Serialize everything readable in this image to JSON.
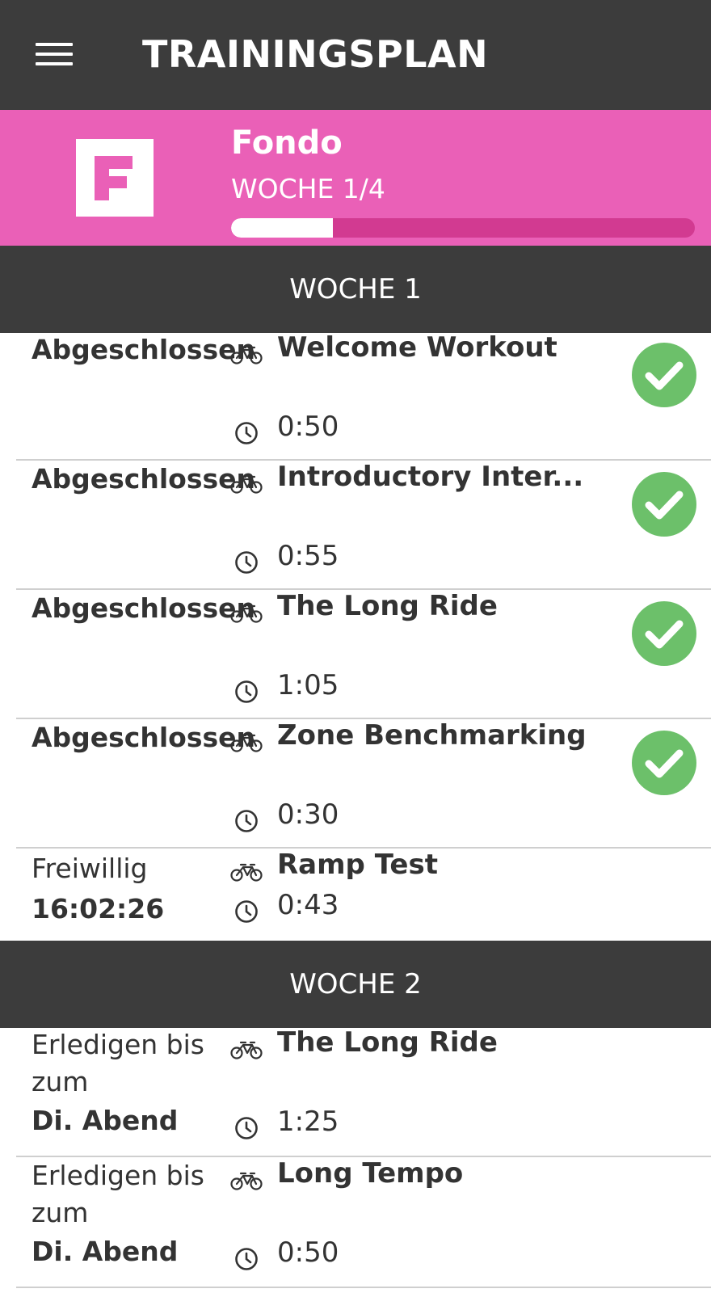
{
  "header": {
    "title": "TRAININGSPLAN",
    "menu_icon": "hamburger-menu-icon"
  },
  "plan": {
    "name": "Fondo",
    "logo_letter": "F",
    "week_label": "WOCHE 1/4",
    "progress_fraction": 0.22,
    "colors": {
      "banner": "#ea60b7",
      "track": "#d23a91",
      "fill": "#ffffff"
    }
  },
  "weeks": [
    {
      "title": "WOCHE 1",
      "workouts": [
        {
          "status": "Abgeschlossen",
          "status_detail": "",
          "name": "Welcome Workout",
          "duration": "0:50",
          "completed": true
        },
        {
          "status": "Abgeschlossen",
          "status_detail": "",
          "name": "Introductory Inter...",
          "duration": "0:55",
          "completed": true
        },
        {
          "status": "Abgeschlossen",
          "status_detail": "",
          "name": "The Long Ride",
          "duration": "1:05",
          "completed": true
        },
        {
          "status": "Abgeschlossen",
          "status_detail": "",
          "name": "Zone Benchmarking",
          "duration": "0:30",
          "completed": true
        },
        {
          "status": "Freiwillig",
          "status_detail": "16:02:26",
          "name": "Ramp Test",
          "duration": "0:43",
          "completed": false
        }
      ]
    },
    {
      "title": "WOCHE 2",
      "workouts": [
        {
          "status": "Erledigen bis zum",
          "status_detail": "Di. Abend",
          "name": "The Long Ride",
          "duration": "1:25",
          "completed": false
        },
        {
          "status": "Erledigen bis zum",
          "status_detail": "Di. Abend",
          "name": "Long Tempo",
          "duration": "0:50",
          "completed": false
        }
      ]
    }
  ],
  "icons": {
    "bike": "bicycle-icon",
    "clock": "clock-icon",
    "check": "checkmark-circle-icon"
  },
  "colors": {
    "dark_bar": "#3c3c3c",
    "check_green": "#6cc06a",
    "divider": "#cfcfcf",
    "text": "#333333"
  }
}
